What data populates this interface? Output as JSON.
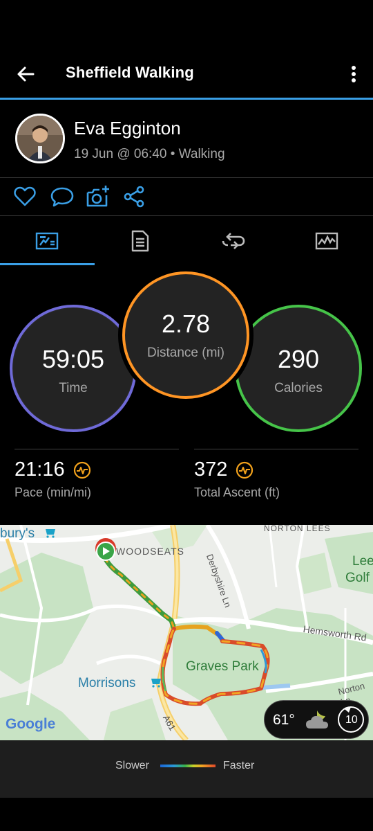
{
  "header": {
    "title": "Sheffield Walking",
    "back_icon": "arrow-back-icon",
    "menu_icon": "more-vert-icon"
  },
  "profile": {
    "name": "Eva Egginton",
    "meta": "19 Jun @ 06:40 • Walking"
  },
  "actions": [
    "heart-icon",
    "comment-icon",
    "add-photo-icon",
    "share-icon"
  ],
  "tabs": [
    "overview-tab",
    "details-tab",
    "laps-tab",
    "charts-tab"
  ],
  "stats": {
    "time": {
      "value": "59:05",
      "label": "Time",
      "color": "#6f6ad8"
    },
    "distance": {
      "value": "2.78",
      "label": "Distance (mi)",
      "color": "#ff9524"
    },
    "calories": {
      "value": "290",
      "label": "Calories",
      "color": "#46c449"
    },
    "pace": {
      "value": "21:16",
      "label": "Pace (min/mi)"
    },
    "ascent": {
      "value": "372",
      "label": "Total Ascent (ft)"
    }
  },
  "map": {
    "labels": {
      "burys": "bury's",
      "woodseats": "WOODSEATS",
      "derbyshire": "Derbyshire Ln",
      "norton_lees": "NORTON LEES",
      "lees": "Lees",
      "golf": "Golf",
      "hemsworth": "Hemsworth Rd",
      "graves": "Graves Park",
      "morrisons": "Morrisons",
      "norton_ln": "Norton Ln",
      "a61": "A61",
      "google": "Google"
    },
    "weather": {
      "temp": "61°",
      "wind": "10"
    }
  },
  "legend": {
    "slower": "Slower",
    "faster": "Faster"
  }
}
